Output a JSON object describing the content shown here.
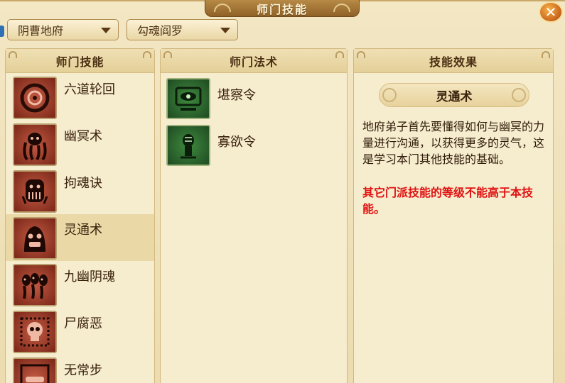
{
  "window": {
    "title": "师门技能"
  },
  "dropdowns": {
    "sect": "阴曹地府",
    "master": "勾魂阎罗"
  },
  "panels": {
    "skills_header": "师门技能",
    "spells_header": "师门法术",
    "effect_header": "技能效果"
  },
  "skills": [
    {
      "label": "六道轮回",
      "icon": "wheel-icon"
    },
    {
      "label": "幽冥术",
      "icon": "ghost-tentacles-icon"
    },
    {
      "label": "拘魂诀",
      "icon": "caged-spirit-icon"
    },
    {
      "label": "灵通术",
      "icon": "spirit-face-icon",
      "selected": true
    },
    {
      "label": "九幽阴魂",
      "icon": "three-ghosts-icon"
    },
    {
      "label": "尸腐恶",
      "icon": "skull-icon"
    },
    {
      "label": "无常步",
      "icon": "footstep-icon"
    }
  ],
  "spells": [
    {
      "label": "堪察令",
      "icon": "eye-scroll-icon"
    },
    {
      "label": "寡欲令",
      "icon": "totem-icon"
    }
  ],
  "effect": {
    "title": "灵通术",
    "description": "地府弟子首先要懂得如何与幽冥的力量进行沟通，以获得更多的灵气，这是学习本门其他技能的基础。",
    "warning": "其它门派技能的等级不能高于本技能。"
  },
  "colors": {
    "warning": "#e01010",
    "selected_bg": "#ead9a6",
    "title_tab": "#a3753a"
  }
}
